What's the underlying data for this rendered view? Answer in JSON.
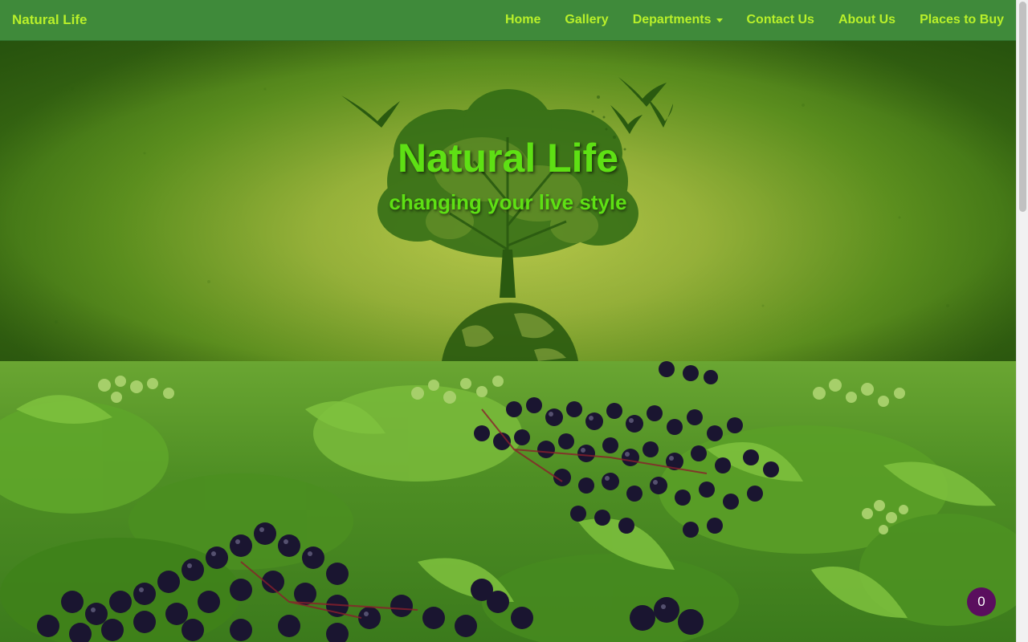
{
  "brand": "Natural Life",
  "nav": {
    "home": "Home",
    "gallery": "Gallery",
    "departments": "Departments",
    "contact": "Contact Us",
    "about": "About Us",
    "places": "Places to Buy"
  },
  "hero": {
    "title": "Natural Life",
    "subtitle": "changing your live style"
  },
  "cart": {
    "count": "0"
  },
  "colors": {
    "navbar": "#3f8a3a",
    "nav_text": "#b9f02a",
    "hero_text": "#5ee014",
    "cart_badge": "#5a0e5e"
  },
  "icons": {
    "hero_art": "tree-globe-birds-illustration",
    "dropdown": "caret-down-icon"
  }
}
